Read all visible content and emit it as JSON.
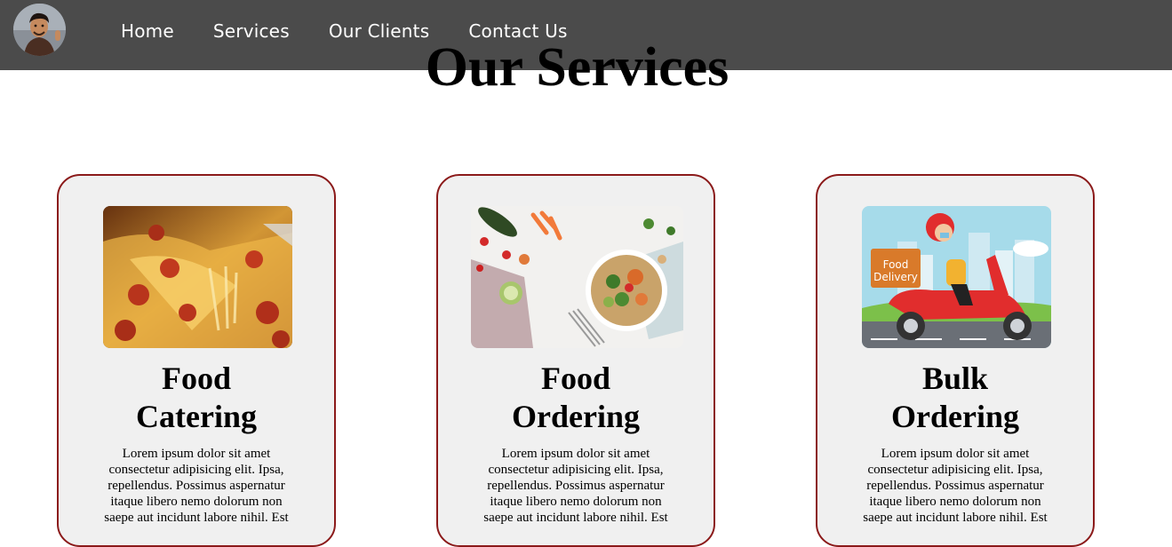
{
  "nav": {
    "links": [
      "Home",
      "Services",
      "Our Clients",
      "Contact Us"
    ]
  },
  "page": {
    "title": "Our Services"
  },
  "cards": [
    {
      "title_line1": "Food",
      "title_line2": "Catering",
      "text": "Lorem ipsum dolor sit amet consectetur adipisicing elit. Ipsa, repellendus. Possimus aspernatur itaque libero nemo dolorum non saepe aut incidunt labore nihil. Est"
    },
    {
      "title_line1": "Food",
      "title_line2": "Ordering",
      "text": "Lorem ipsum dolor sit amet consectetur adipisicing elit. Ipsa, repellendus. Possimus aspernatur itaque libero nemo dolorum non saepe aut incidunt labore nihil. Est"
    },
    {
      "title_line1": "Bulk",
      "title_line2": "Ordering",
      "text": "Lorem ipsum dolor sit amet consectetur adipisicing elit. Ipsa, repellendus. Possimus aspernatur itaque libero nemo dolorum non saepe aut incidunt labore nihil. Est",
      "image_sign": [
        "Food",
        "Delivery"
      ]
    }
  ],
  "colors": {
    "navbar": "#4b4b4b",
    "card_border": "#8b1a1a",
    "card_bg": "#f0f0f0"
  }
}
